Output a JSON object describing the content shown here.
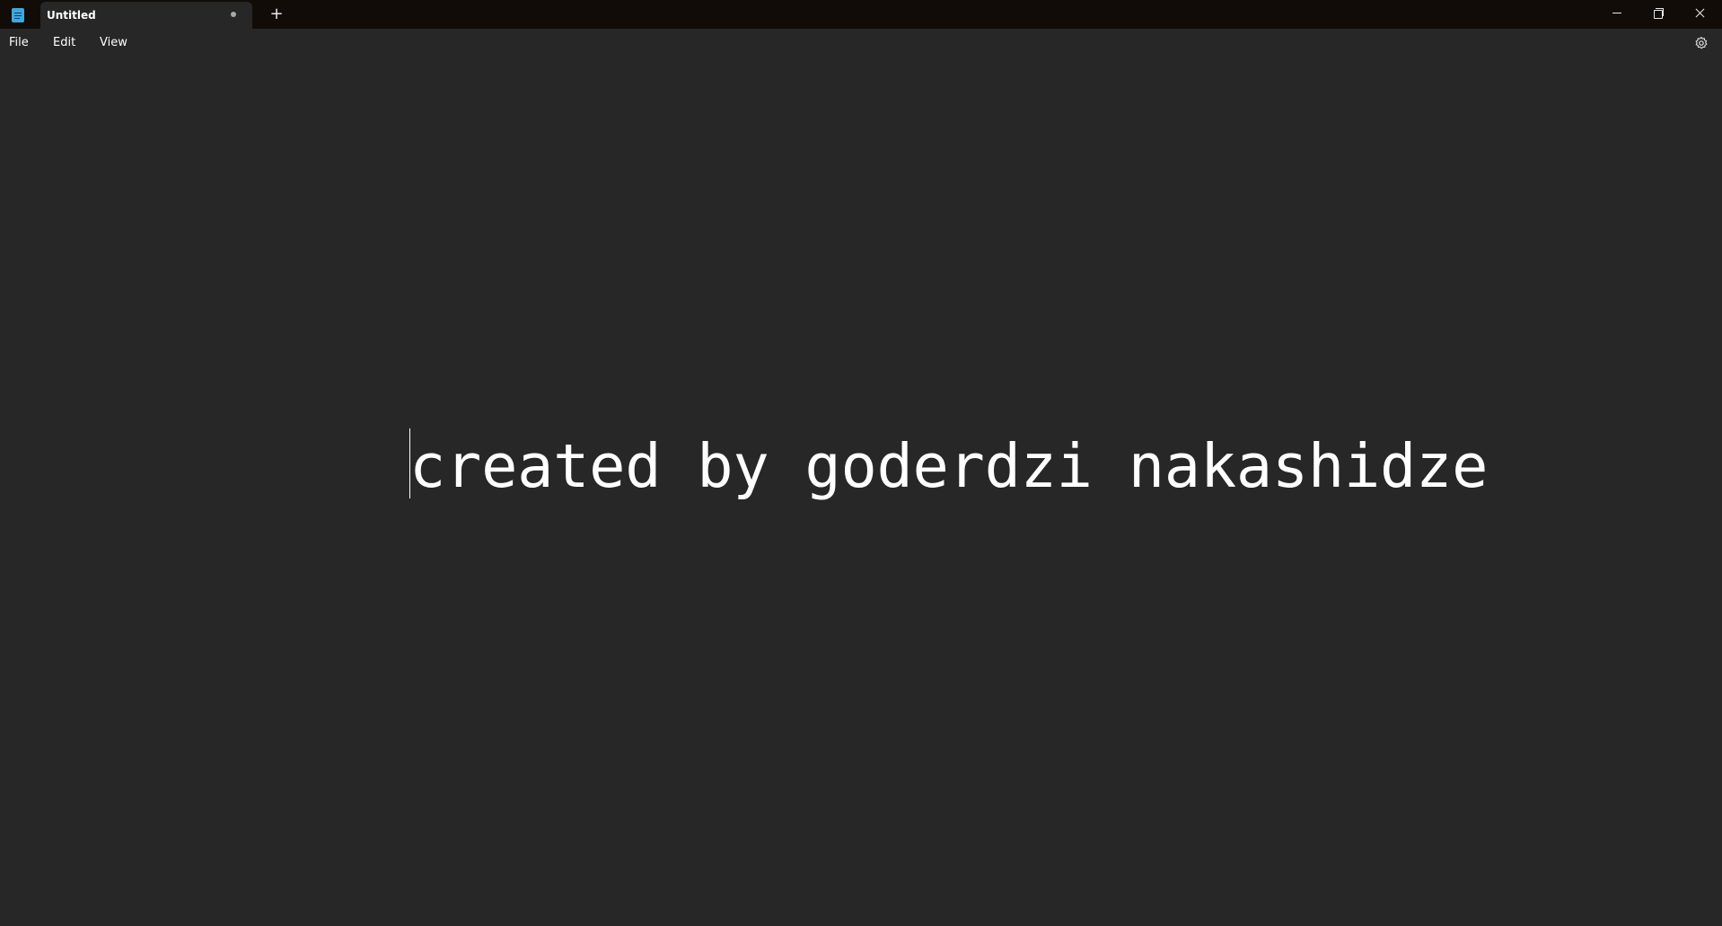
{
  "window": {
    "tab_title": "Untitled",
    "new_tab_symbol": "+",
    "unsaved": true
  },
  "menu": {
    "file": "File",
    "edit": "Edit",
    "view": "View"
  },
  "editor": {
    "content": "created by goderdzi nakashidze"
  },
  "colors": {
    "titlebar_bg": "#110c08",
    "editor_bg": "#272727",
    "text": "#ffffff",
    "app_icon": "#3fa7e0"
  },
  "icons": {
    "app": "notepad-icon",
    "settings": "gear-icon",
    "minimize": "minimize-icon",
    "maximize": "restore-icon",
    "close": "close-icon"
  }
}
